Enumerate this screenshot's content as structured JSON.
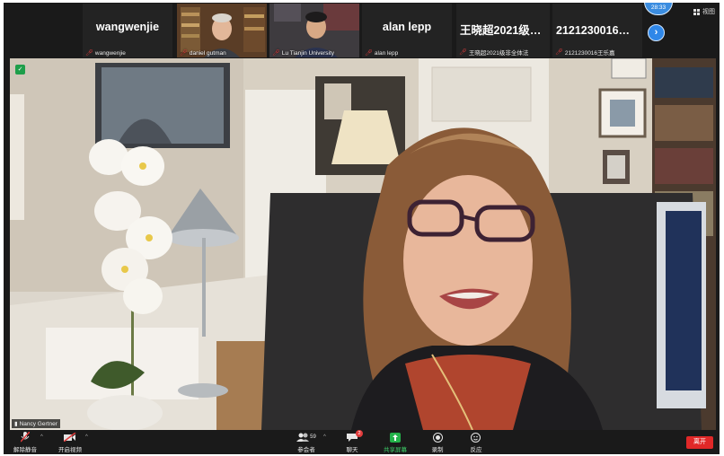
{
  "gallery": {
    "tiles": [
      {
        "big": "wangwenjie",
        "small": "wangwenjie"
      },
      {
        "small": "daniel gutman"
      },
      {
        "small": "Lu Tianjin University"
      },
      {
        "big": "alan lepp",
        "small": "alan lepp"
      },
      {
        "big": "王晓超2021级非...",
        "small": "王晓超2021级非全体法"
      },
      {
        "big": "2121230016王...",
        "small": "2121230016王乐嘉"
      }
    ]
  },
  "top_controls": {
    "clock": "28:33",
    "view_label": "视图",
    "next_icon": "chevron-right-icon"
  },
  "main_video": {
    "speaker_name": "Nancy Gertner"
  },
  "toolbar": {
    "unmute": "解除静音",
    "start_video": "开启视频",
    "participants": "参会者",
    "participants_count": "59",
    "chat": "聊天",
    "chat_badge": "2",
    "share_screen": "共享屏幕",
    "record": "录制",
    "reactions": "反应",
    "leave": "离开"
  },
  "colors": {
    "accent": "#2f87e8",
    "share_green": "#23b34a",
    "leave_red": "#e02828",
    "muted_red": "#e03b3b"
  }
}
